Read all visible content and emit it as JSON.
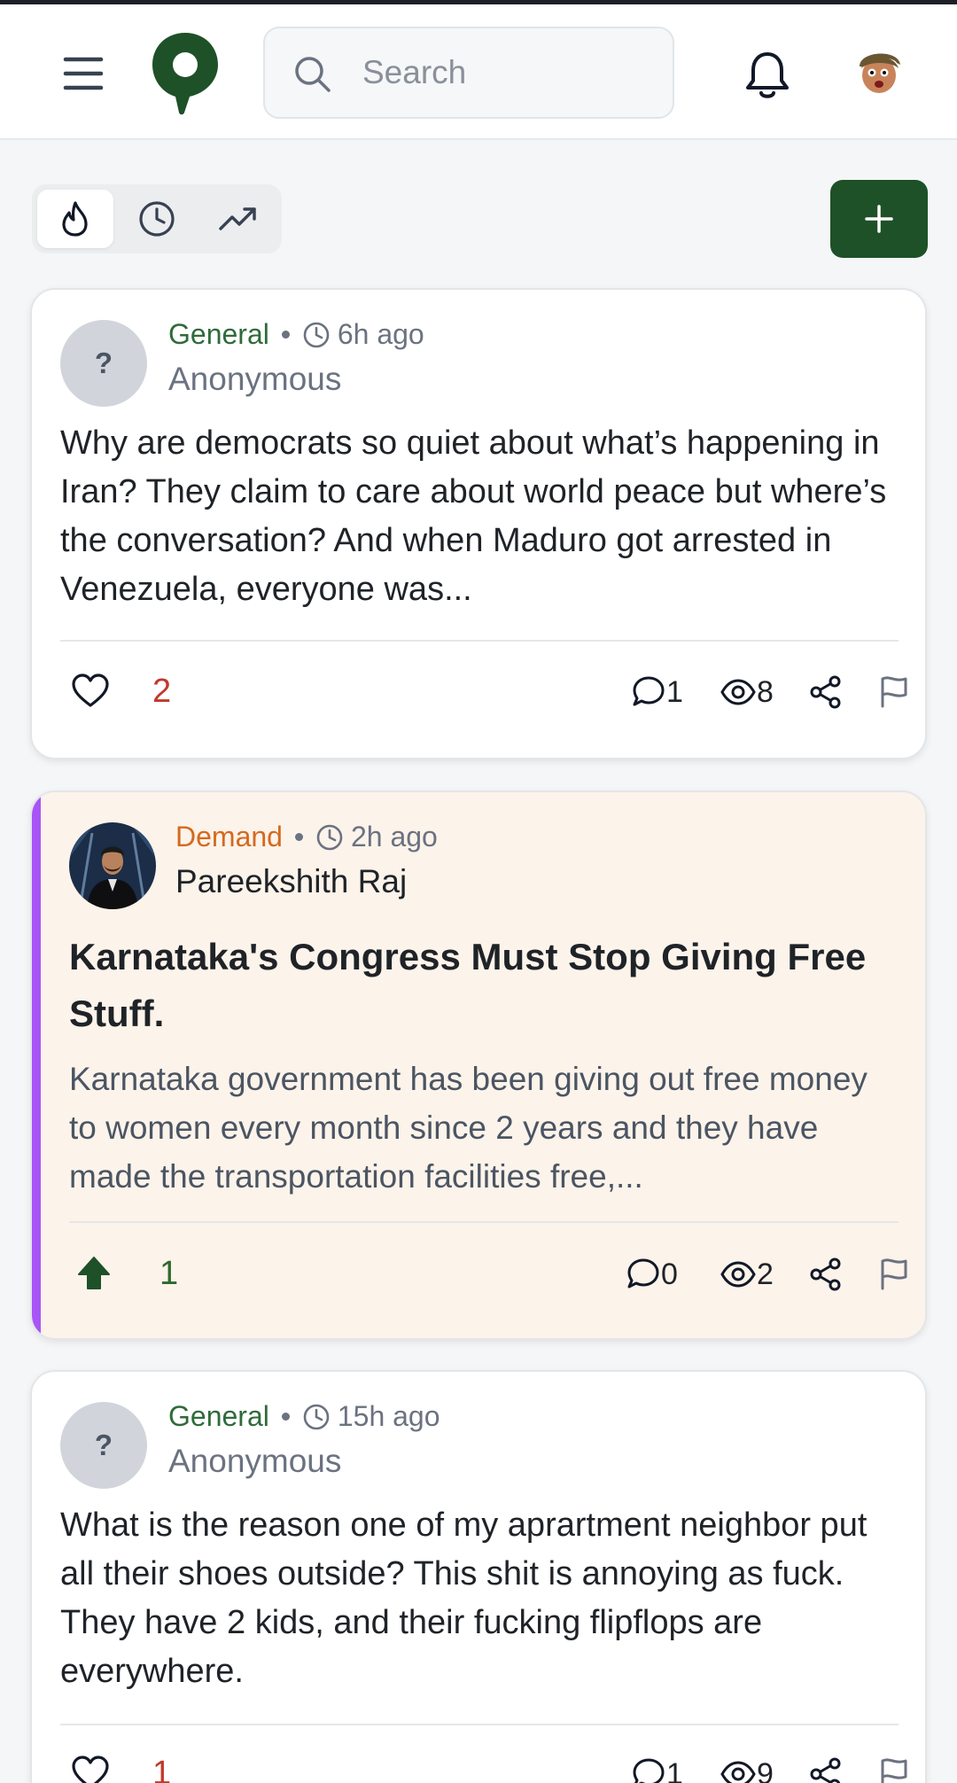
{
  "search": {
    "placeholder": "Search"
  },
  "sort_tabs": [
    {
      "icon": "flame-icon",
      "active": true
    },
    {
      "icon": "clock-icon",
      "active": false
    },
    {
      "icon": "trending-up-icon",
      "active": false
    }
  ],
  "posts": [
    {
      "category": "General",
      "time": "6h ago",
      "author": "Anonymous",
      "avatar_text": "?",
      "body": "Why are democrats so quiet about what’s happening in Iran? They claim to care about world peace but where’s the conversation? And when Maduro got arrested in Venezuela, everyone was...",
      "likes": "2",
      "comments": "1",
      "views": "8"
    },
    {
      "category": "Demand",
      "time": "2h ago",
      "author": "Pareekshith Raj",
      "title": "Karnataka's Congress Must Stop Giving Free Stuff.",
      "excerpt": "Karnataka government has been giving out free money to women every month since 2 years and they have made the transportation facilities free,...",
      "upvotes": "1",
      "comments": "0",
      "views": "2"
    },
    {
      "category": "General",
      "time": "15h ago",
      "author": "Anonymous",
      "avatar_text": "?",
      "body": "What is the reason one of my aprartment neighbor put all their shoes outside? This shit is annoying as fuck. They have 2 kids, and their fucking flipflops are everywhere.",
      "likes": "1",
      "comments": "1",
      "views": "9"
    }
  ],
  "colors": {
    "brand_green": "#1e5128",
    "general_category": "#2f6b3a",
    "demand_category": "#d46a1f",
    "demand_accent": "#a855f7",
    "demand_card_bg": "#fcf3ea",
    "like_count": "#c0392b"
  }
}
